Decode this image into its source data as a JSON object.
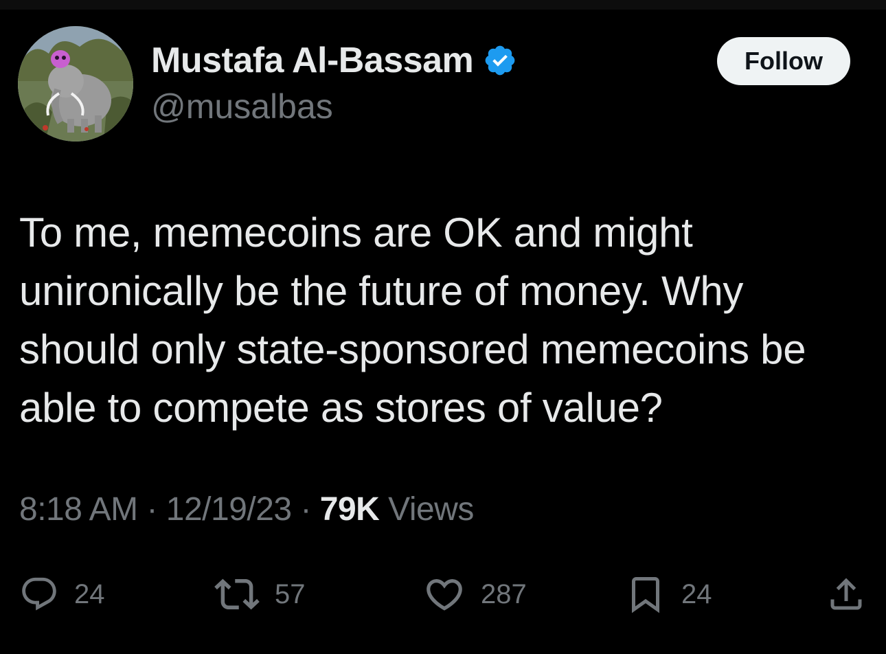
{
  "author": {
    "display_name": "Mustafa Al-Bassam",
    "handle": "@musalbas",
    "verified_icon": "verified-badge-icon",
    "verified_color": "#1d9bf0"
  },
  "follow_label": "Follow",
  "tweet": {
    "text": "To me, memecoins are OK and might unironically be the future of money. Why should only state-sponsored memecoins be able to compete as stores of value?"
  },
  "meta": {
    "time": "8:18 AM",
    "sep1": " · ",
    "date": "12/19/23",
    "sep2": " · ",
    "views_count": "79K",
    "views_label": " Views"
  },
  "actions": {
    "replies": {
      "icon": "reply-icon",
      "count": "24"
    },
    "retweets": {
      "icon": "retweet-icon",
      "count": "57"
    },
    "likes": {
      "icon": "heart-icon",
      "count": "287"
    },
    "bookmarks": {
      "icon": "bookmark-icon",
      "count": "24"
    },
    "share": {
      "icon": "share-icon"
    }
  },
  "colors": {
    "background": "#000000",
    "text": "#e7e9ea",
    "secondary": "#71767b",
    "button_bg": "#eff3f4"
  }
}
